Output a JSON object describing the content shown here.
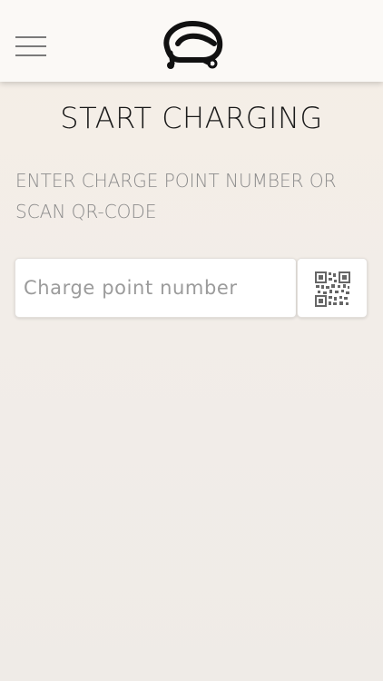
{
  "header": {
    "menu_icon": "hamburger-menu-icon",
    "logo_icon": "ev-charger-logo-icon"
  },
  "main": {
    "title": "START CHARGING",
    "instruction": "ENTER CHARGE POINT NUMBER OR SCAN QR-CODE",
    "charge_point_input": {
      "placeholder": "Charge point number",
      "value": ""
    },
    "qr_button": {
      "icon": "qr-code-icon"
    }
  },
  "colors": {
    "background_top": "#f5eee6",
    "background_bottom": "#efebe7",
    "header_bg": "#fbf9f6",
    "title_text": "#1a1a1a",
    "muted_text": "#8b8b8b"
  }
}
